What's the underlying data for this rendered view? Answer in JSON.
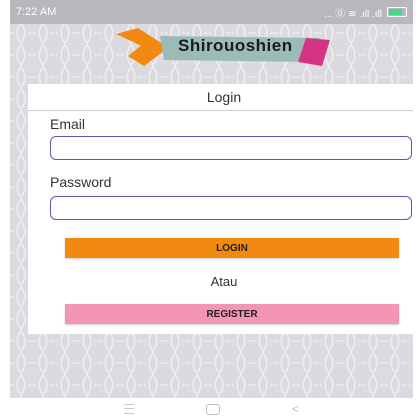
{
  "status_bar": {
    "time": "7:22 AM",
    "indicators": "... ⓪ ≋ .ıll .ıll",
    "battery_color": "#3ddc84"
  },
  "logo": {
    "text": "Shirouoshien"
  },
  "login_card": {
    "title": "Login",
    "email_label": "Email",
    "email_value": "",
    "password_label": "Password",
    "password_value": "",
    "login_button": "LOGIN",
    "or_text": "Atau",
    "register_button": "REGISTER"
  },
  "colors": {
    "login_button": "#f28a12",
    "register_button": "#f295b6",
    "field_border": "#5b56b0"
  },
  "nav_bar": {
    "back_glyph": "<"
  }
}
